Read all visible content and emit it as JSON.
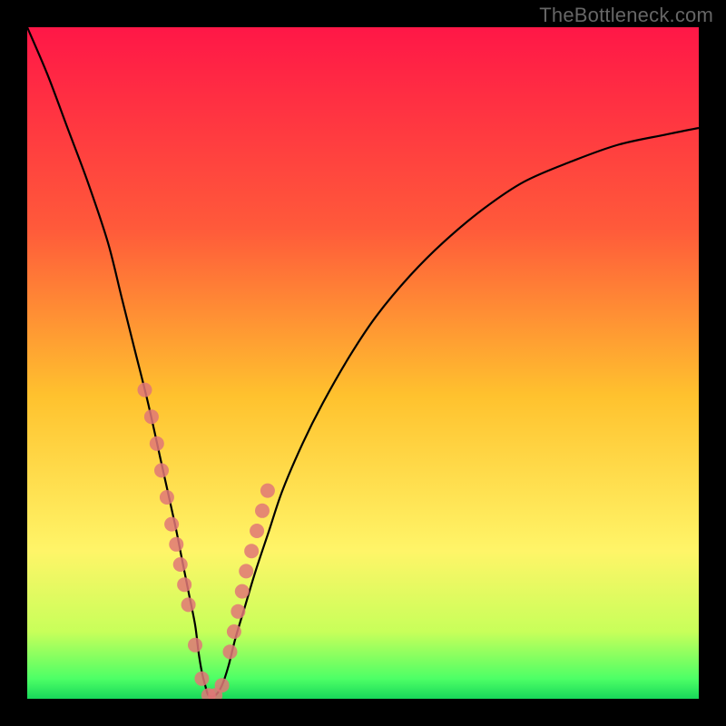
{
  "watermark": "TheBottleneck.com",
  "chart_data": {
    "type": "line",
    "title": "",
    "xlabel": "",
    "ylabel": "",
    "xlim": [
      0,
      100
    ],
    "ylim": [
      0,
      100
    ],
    "background_gradient": {
      "stops": [
        {
          "offset": 0.0,
          "color": "#ff1747"
        },
        {
          "offset": 0.3,
          "color": "#ff5a3a"
        },
        {
          "offset": 0.55,
          "color": "#ffc22e"
        },
        {
          "offset": 0.78,
          "color": "#fff568"
        },
        {
          "offset": 0.9,
          "color": "#c8ff5a"
        },
        {
          "offset": 0.97,
          "color": "#4dff66"
        },
        {
          "offset": 1.0,
          "color": "#18d85a"
        }
      ]
    },
    "series": [
      {
        "name": "bottleneck-curve",
        "color": "#000000",
        "x": [
          0,
          3,
          6,
          9,
          12,
          14,
          16,
          18,
          20,
          22,
          23,
          24,
          25,
          25.5,
          26,
          26.5,
          27,
          28,
          29,
          30,
          31,
          32.5,
          34,
          36,
          38,
          41,
          44,
          48,
          52,
          57,
          62,
          68,
          74,
          81,
          88,
          95,
          100
        ],
        "y": [
          100,
          93,
          85,
          77,
          68,
          60,
          52,
          44,
          35,
          26,
          21,
          16,
          11,
          7,
          4,
          2,
          0.5,
          0.5,
          2,
          5,
          9,
          14,
          19,
          25,
          31,
          38,
          44,
          51,
          57,
          63,
          68,
          73,
          77,
          80,
          82.5,
          84,
          85
        ]
      },
      {
        "name": "curve-markers",
        "type": "scatter",
        "color": "#e07777",
        "x": [
          17.5,
          18.5,
          19.3,
          20.0,
          20.8,
          21.5,
          22.2,
          22.8,
          23.4,
          24.0,
          25.0,
          26.0,
          27.0,
          28.0,
          29.0,
          30.2,
          30.8,
          31.4,
          32.0,
          32.6,
          33.4,
          34.2,
          35.0,
          35.8
        ],
        "y": [
          46,
          42,
          38,
          34,
          30,
          26,
          23,
          20,
          17,
          14,
          8,
          3,
          0.5,
          0.5,
          2,
          7,
          10,
          13,
          16,
          19,
          22,
          25,
          28,
          31
        ]
      }
    ]
  }
}
